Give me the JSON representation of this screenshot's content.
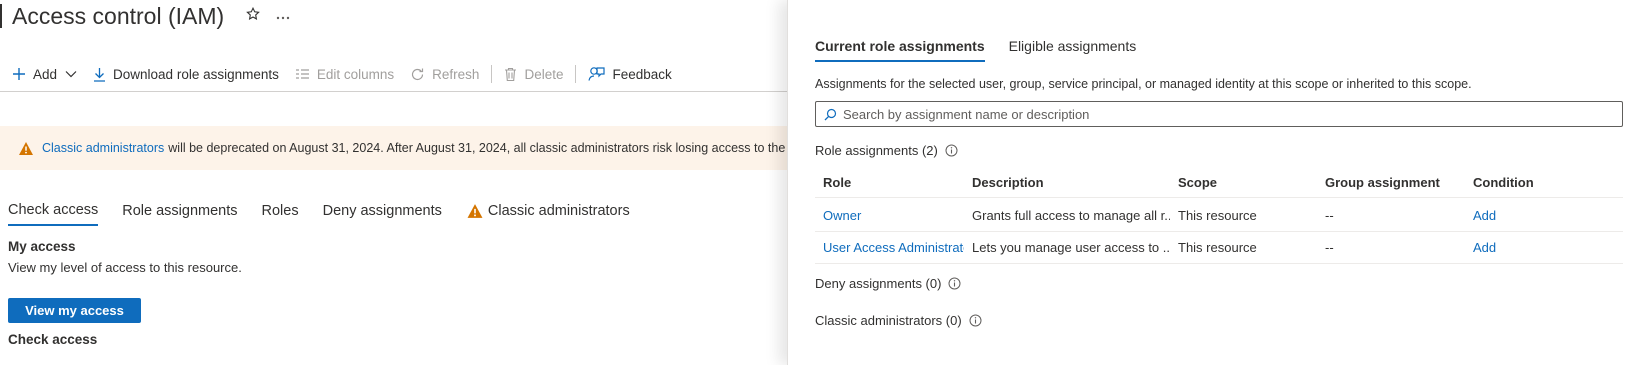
{
  "page": {
    "title": "Access control (IAM)",
    "icons": {
      "favorite": "star-icon",
      "more": "more-icon"
    }
  },
  "toolbar": {
    "add_label": "Add",
    "download_label": "Download role assignments",
    "edit_columns_label": "Edit columns",
    "refresh_label": "Refresh",
    "delete_label": "Delete",
    "feedback_label": "Feedback"
  },
  "banner": {
    "link_text": "Classic administrators",
    "message": "will be deprecated on August 31, 2024. After August 31, 2024, all classic administrators risk losing access to the subscription."
  },
  "tabs": [
    {
      "label": "Check access",
      "active": true
    },
    {
      "label": "Role assignments",
      "active": false
    },
    {
      "label": "Roles",
      "active": false
    },
    {
      "label": "Deny assignments",
      "active": false
    },
    {
      "label": "Classic administrators",
      "active": false
    }
  ],
  "my_access": {
    "heading": "My access",
    "description": "View my level of access to this resource.",
    "button_label": "View my access"
  },
  "check_access": {
    "heading": "Check access"
  },
  "panel": {
    "tabs": [
      {
        "label": "Current role assignments",
        "active": true
      },
      {
        "label": "Eligible assignments",
        "active": false
      }
    ],
    "description": "Assignments for the selected user, group, service principal, or managed identity at this scope or inherited to this scope.",
    "search_placeholder": "Search by assignment name or description",
    "role_assignments_heading": "Role assignments (2)",
    "columns": [
      "Role",
      "Description",
      "Scope",
      "Group assignment",
      "Condition"
    ],
    "rows": [
      {
        "role": "Owner",
        "description": "Grants full access to manage all r...",
        "scope": "This resource",
        "group": "--",
        "condition": "Add"
      },
      {
        "role": "User Access Administrator",
        "description": "Lets you manage user access to ...",
        "scope": "This resource",
        "group": "--",
        "condition": "Add"
      }
    ],
    "deny_heading": "Deny assignments (0)",
    "classic_heading": "Classic administrators (0)"
  },
  "colors": {
    "accent": "#0f6cbd",
    "warning": "#d47500",
    "banner_bg": "#fdf3e9"
  }
}
